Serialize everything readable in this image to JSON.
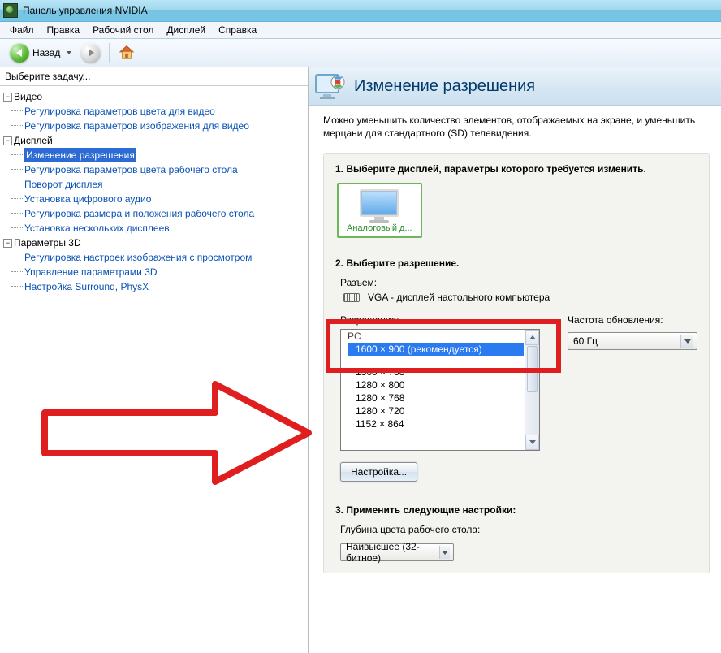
{
  "window": {
    "title": "Панель управления NVIDIA"
  },
  "menu": {
    "file": "Файл",
    "edit": "Правка",
    "desktop": "Рабочий стол",
    "display": "Дисплей",
    "help": "Справка"
  },
  "toolbar": {
    "back_label": "Назад"
  },
  "left": {
    "header": "Выберите задачу...",
    "tree": {
      "video": {
        "label": "Видео",
        "items": [
          "Регулировка параметров цвета для видео",
          "Регулировка параметров изображения для видео"
        ]
      },
      "display": {
        "label": "Дисплей",
        "items": [
          "Изменение разрешения",
          "Регулировка параметров цвета рабочего стола",
          "Поворот дисплея",
          "Установка цифрового аудио",
          "Регулировка размера и положения рабочего стола",
          "Установка нескольких дисплеев"
        ],
        "selected_index": 0
      },
      "params3d": {
        "label": "Параметры 3D",
        "items": [
          "Регулировка настроек изображения с просмотром",
          "Управление параметрами 3D",
          "Настройка Surround, PhysX"
        ]
      }
    }
  },
  "page": {
    "title": "Изменение разрешения",
    "intro": "Можно уменьшить количество элементов, отображаемых на экране, и уменьшить мерцани для стандартного (SD) телевидения.",
    "step1_title": "1. Выберите дисплей, параметры которого требуется изменить.",
    "display_name": "Аналоговый д...",
    "step2_title": "2. Выберите разрешение.",
    "connector_label": "Разъем:",
    "connector_value": "VGA - дисплей настольного компьютера",
    "resolution_label": "Разрешение:",
    "refresh_label": "Частота обновления:",
    "refresh_value": "60 Гц",
    "resolutions": {
      "group": "PC",
      "items": [
        "1600 × 900 (рекомендуется)",
        "1360 × 768",
        "1280 × 800",
        "1280 × 768",
        "1280 × 720",
        "1152 × 864"
      ],
      "selected_index": 0
    },
    "customize_button": "Настройка...",
    "step3_title": "3. Применить следующие настройки:",
    "color_depth_label": "Глубина цвета рабочего стола:",
    "color_depth_value": "Наивысшее (32-битное)"
  }
}
